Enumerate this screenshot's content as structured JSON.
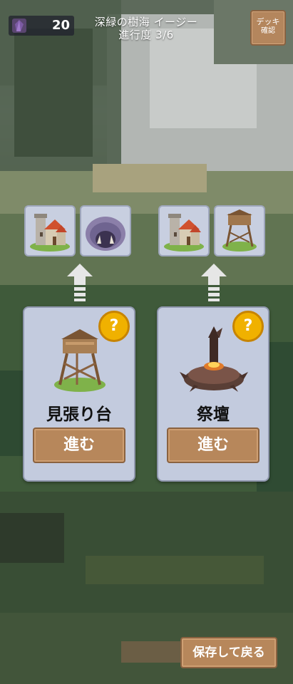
{
  "header": {
    "currency_amount": "20",
    "title_line1": "深緑の樹海 イージー",
    "title_line2": "進行度 3/6",
    "deck_button_line1": "デッキ",
    "deck_button_line2": "確認"
  },
  "choices": [
    {
      "name": "見張り台",
      "action_label": "進む",
      "help_label": "?",
      "preview_icons": [
        "castle-icon",
        "cave-icon"
      ]
    },
    {
      "name": "祭壇",
      "action_label": "進む",
      "help_label": "?",
      "preview_icons": [
        "castle-icon",
        "watchtower-icon"
      ]
    }
  ],
  "footer": {
    "save_button_label": "保存して戻る"
  },
  "colors": {
    "button_brown": "#b7875b",
    "card_bg": "#c3cbde",
    "help_badge": "#f0b100"
  }
}
